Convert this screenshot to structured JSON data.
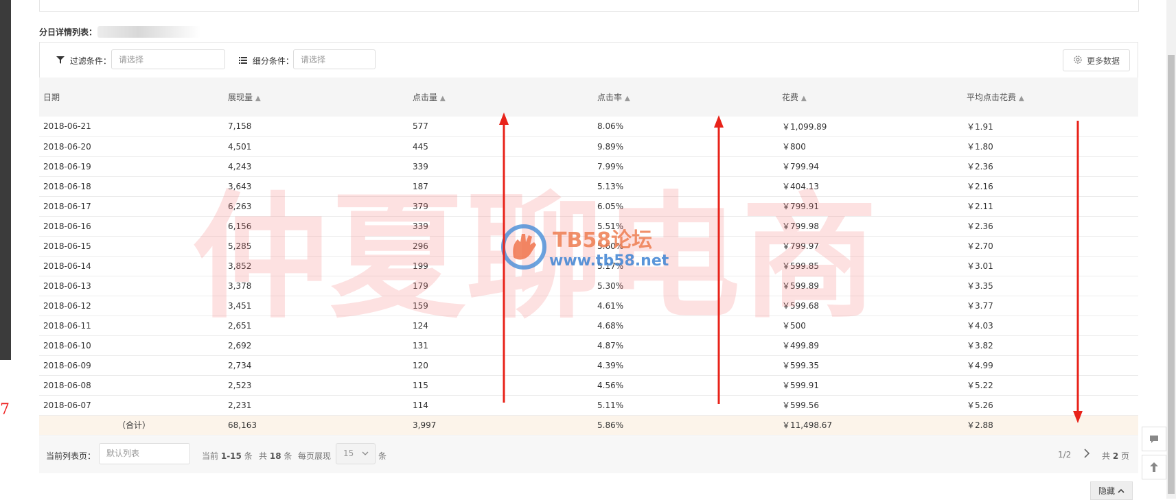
{
  "section_title": "分日详情列表：",
  "filter": {
    "filter_label": "过滤条件：",
    "filter_placeholder": "请选择",
    "segment_label": "细分条件：",
    "segment_placeholder": "请选择",
    "more_data_label": "更多数据"
  },
  "table": {
    "columns": [
      "日期",
      "展现量",
      "点击量",
      "点击率",
      "花费",
      "平均点击花费"
    ],
    "rows": [
      [
        "2018-06-21",
        "7,158",
        "577",
        "8.06%",
        "￥1,099.89",
        "￥1.91"
      ],
      [
        "2018-06-20",
        "4,501",
        "445",
        "9.89%",
        "￥800",
        "￥1.80"
      ],
      [
        "2018-06-19",
        "4,243",
        "339",
        "7.99%",
        "￥799.94",
        "￥2.36"
      ],
      [
        "2018-06-18",
        "3,643",
        "187",
        "5.13%",
        "￥404.13",
        "￥2.16"
      ],
      [
        "2018-06-17",
        "6,263",
        "379",
        "6.05%",
        "￥799.91",
        "￥2.11"
      ],
      [
        "2018-06-16",
        "6,156",
        "339",
        "5.51%",
        "￥799.98",
        "￥2.36"
      ],
      [
        "2018-06-15",
        "5,285",
        "296",
        "5.60%",
        "￥799.97",
        "￥2.70"
      ],
      [
        "2018-06-14",
        "3,852",
        "199",
        "5.17%",
        "￥599.85",
        "￥3.01"
      ],
      [
        "2018-06-13",
        "3,378",
        "179",
        "5.30%",
        "￥599.89",
        "￥3.35"
      ],
      [
        "2018-06-12",
        "3,451",
        "159",
        "4.61%",
        "￥599.68",
        "￥3.77"
      ],
      [
        "2018-06-11",
        "2,651",
        "124",
        "4.68%",
        "￥500",
        "￥4.03"
      ],
      [
        "2018-06-10",
        "2,692",
        "131",
        "4.87%",
        "￥499.89",
        "￥3.82"
      ],
      [
        "2018-06-09",
        "2,734",
        "120",
        "4.39%",
        "￥599.35",
        "￥4.99"
      ],
      [
        "2018-06-08",
        "2,523",
        "115",
        "4.56%",
        "￥599.91",
        "￥5.22"
      ],
      [
        "2018-06-07",
        "2,231",
        "114",
        "5.11%",
        "￥599.56",
        "￥5.26"
      ]
    ],
    "total": [
      "（合计）",
      "68,163",
      "3,997",
      "5.86%",
      "￥11,498.67",
      "￥2.88"
    ]
  },
  "footer": {
    "current_list_label": "当前列表页：",
    "list_placeholder": "默认列表",
    "current_prefix": "当前",
    "current_range": "1-15",
    "current_suffix": "条",
    "total_prefix": "共",
    "total_count": "18",
    "total_suffix": "条",
    "per_page_label": "每页展现",
    "per_page_value": "15",
    "per_page_unit": "条",
    "page_indicator": "1/2",
    "pages_prefix": "共",
    "pages_count": "2",
    "pages_suffix": "页"
  },
  "hide_label": "隐藏",
  "watermark": {
    "main": "仲夏聊电商",
    "forum": "TB58论坛",
    "url": "www.tb58.net"
  },
  "side_char": "7",
  "colors": {
    "arrow": "#e8231a",
    "total_row": "#fcf4ea",
    "header_bg": "#f5f5f5"
  },
  "icons": [
    "filter-icon",
    "list-icon",
    "gear-icon",
    "sort-up-icon",
    "chevron-down-icon",
    "chevron-right-icon",
    "chat-icon",
    "arrow-up-icon",
    "chevron-up-icon"
  ]
}
